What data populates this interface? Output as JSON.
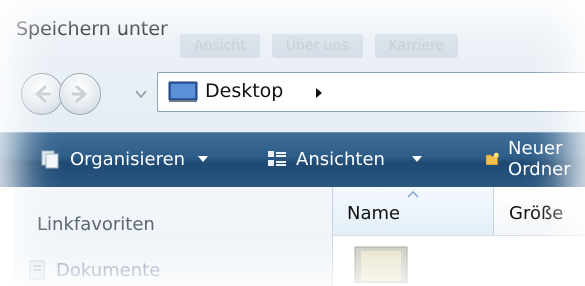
{
  "window": {
    "title": "Speichern unter",
    "ghost_menu": [
      "Ansicht",
      "Über uns",
      "Karriere"
    ]
  },
  "nav": {
    "back_icon": "back-arrow-icon",
    "forward_icon": "forward-arrow-icon",
    "recent_icon": "chevron-down-icon"
  },
  "address": {
    "location": "Desktop",
    "folder_icon": "desktop-icon",
    "crumb_icon": "chevron-right-icon"
  },
  "toolbar": {
    "organize_label": "Organisieren",
    "views_label": "Ansichten",
    "new_folder_label": "Neuer Ordner"
  },
  "navigation_pane": {
    "favorites_heading": "Linkfavoriten",
    "items": [
      {
        "label": "Dokumente",
        "icon": "documents-icon"
      }
    ]
  },
  "file_list": {
    "columns": [
      {
        "label": "Name",
        "sorted": "ascending"
      },
      {
        "label": "Größe"
      }
    ]
  },
  "colors": {
    "toolbar": "#2d5c87",
    "toolbar_text": "#ffffff",
    "address_border": "#8ea3b8",
    "pane_bg": "#eef3f8"
  }
}
